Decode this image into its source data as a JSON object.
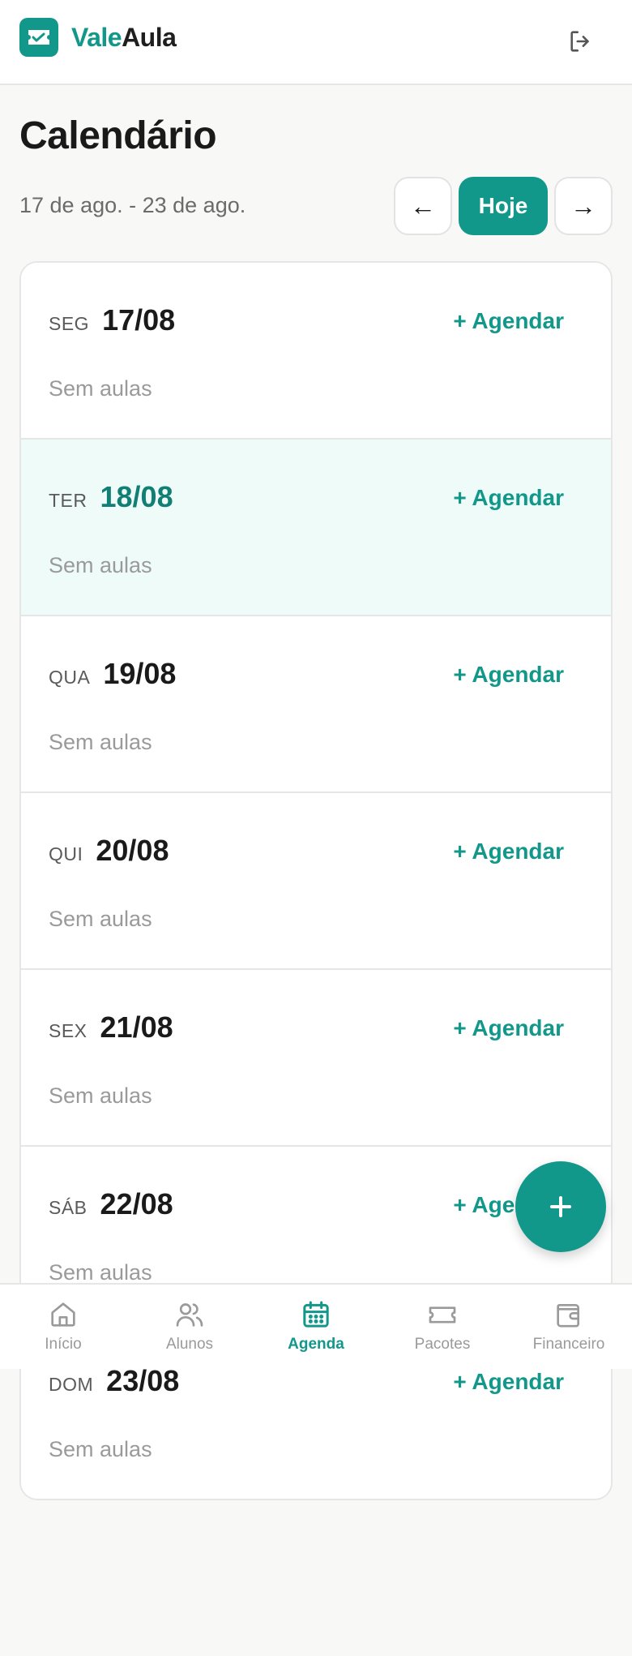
{
  "header": {
    "brand_part1": "Vale",
    "brand_part2": "Aula",
    "logo_icon": "ticket-check-icon",
    "logout_icon": "logout-icon"
  },
  "page": {
    "title": "Calendário",
    "week_range": "17 de ago. - 23 de ago.",
    "prev_label": "←",
    "today_label": "Hoje",
    "next_label": "→"
  },
  "days": [
    {
      "weekday": "SEG",
      "date": "17/08",
      "action": "+ Agendar",
      "empty": "Sem aulas",
      "is_today": false
    },
    {
      "weekday": "TER",
      "date": "18/08",
      "action": "+ Agendar",
      "empty": "Sem aulas",
      "is_today": true
    },
    {
      "weekday": "QUA",
      "date": "19/08",
      "action": "+ Agendar",
      "empty": "Sem aulas",
      "is_today": false
    },
    {
      "weekday": "QUI",
      "date": "20/08",
      "action": "+ Agendar",
      "empty": "Sem aulas",
      "is_today": false
    },
    {
      "weekday": "SEX",
      "date": "21/08",
      "action": "+ Agendar",
      "empty": "Sem aulas",
      "is_today": false
    },
    {
      "weekday": "SÁB",
      "date": "22/08",
      "action": "+ Agendar",
      "empty": "Sem aulas",
      "is_today": false
    },
    {
      "weekday": "DOM",
      "date": "23/08",
      "action": "+ Agendar",
      "empty": "Sem aulas",
      "is_today": false
    }
  ],
  "bottom_nav": [
    {
      "label": "Início",
      "icon": "home-icon",
      "active": false
    },
    {
      "label": "Alunos",
      "icon": "users-icon",
      "active": false
    },
    {
      "label": "Agenda",
      "icon": "calendar-icon",
      "active": true
    },
    {
      "label": "Pacotes",
      "icon": "ticket-icon",
      "active": false
    },
    {
      "label": "Financeiro",
      "icon": "wallet-icon",
      "active": false
    }
  ],
  "fab": {
    "icon": "plus-icon"
  },
  "colors": {
    "accent": "#12988a",
    "today_bg": "#effbf8",
    "muted_text": "#9a9a9a"
  }
}
